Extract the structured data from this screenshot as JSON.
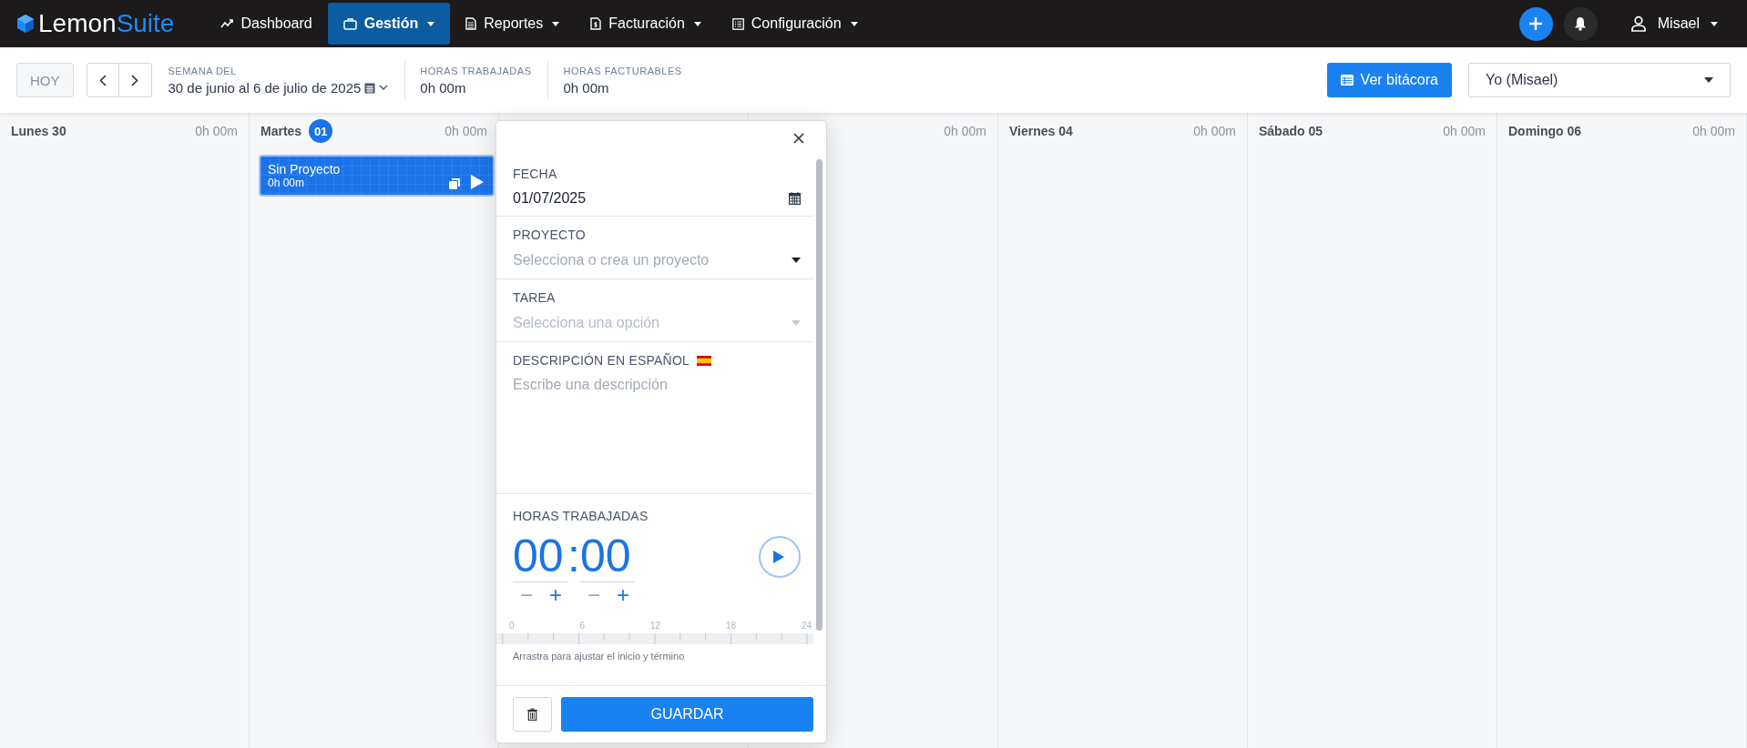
{
  "nav": {
    "logo": {
      "first": "Lemon",
      "second": "Suite"
    },
    "menu": [
      {
        "label": "Dashboard",
        "kind": "link",
        "selected": false
      },
      {
        "label": "Gestión",
        "kind": "dropdown",
        "selected": true
      },
      {
        "label": "Reportes",
        "kind": "dropdown",
        "selected": false
      },
      {
        "label": "Facturación",
        "kind": "dropdown",
        "selected": false
      },
      {
        "label": "Configuración",
        "kind": "dropdown",
        "selected": false
      }
    ],
    "user": "Misael"
  },
  "toolbar": {
    "today": "HOY",
    "week": {
      "label": "SEMANA DEL",
      "value": "30 de junio al 6 de julio de 2025"
    },
    "stats": [
      {
        "label": "HORAS TRABAJADAS",
        "value": "0h 00m"
      },
      {
        "label": "HORAS FACTURABLES",
        "value": "0h 00m"
      }
    ],
    "log_button": "Ver bitácora",
    "person_select": "Yo (Misael)"
  },
  "days": [
    {
      "label": "Lunes 30",
      "total": "0h 00m"
    },
    {
      "label": "Martes",
      "badge": "01",
      "total": "0h 00m",
      "entries": [
        {
          "title": "Sin Proyecto",
          "duration": "0h 00m"
        }
      ]
    },
    {
      "total": "0h 00m"
    },
    {
      "label": "Viernes 04",
      "total": "0h 00m"
    },
    {
      "label": "Sábado 05",
      "total": "0h 00m"
    },
    {
      "label": "Domingo 06",
      "total": "0h 00m"
    }
  ],
  "popup": {
    "fields": [
      {
        "kind": "date",
        "label": "FECHA",
        "value": "01/07/2025"
      },
      {
        "kind": "select",
        "label": "PROYECTO",
        "placeholder": "Selecciona o crea un proyecto",
        "disabled": false
      },
      {
        "kind": "select",
        "label": "TAREA",
        "placeholder": "Selecciona una opción",
        "disabled": true
      },
      {
        "kind": "textarea",
        "label": "DESCRIPCIÓN EN ESPAÑOL",
        "placeholder": "Escribe una descripción"
      }
    ],
    "hours": {
      "label": "HORAS TRABAJADAS",
      "hours": "00",
      "separator": ":",
      "minutes": "00",
      "minus": "−",
      "plus": "+"
    },
    "timeline": {
      "ticks": [
        "0",
        "6",
        "12",
        "18",
        "24"
      ],
      "hint": "Arrastra para ajustar el inicio y término"
    },
    "save": "GUARDAR"
  }
}
